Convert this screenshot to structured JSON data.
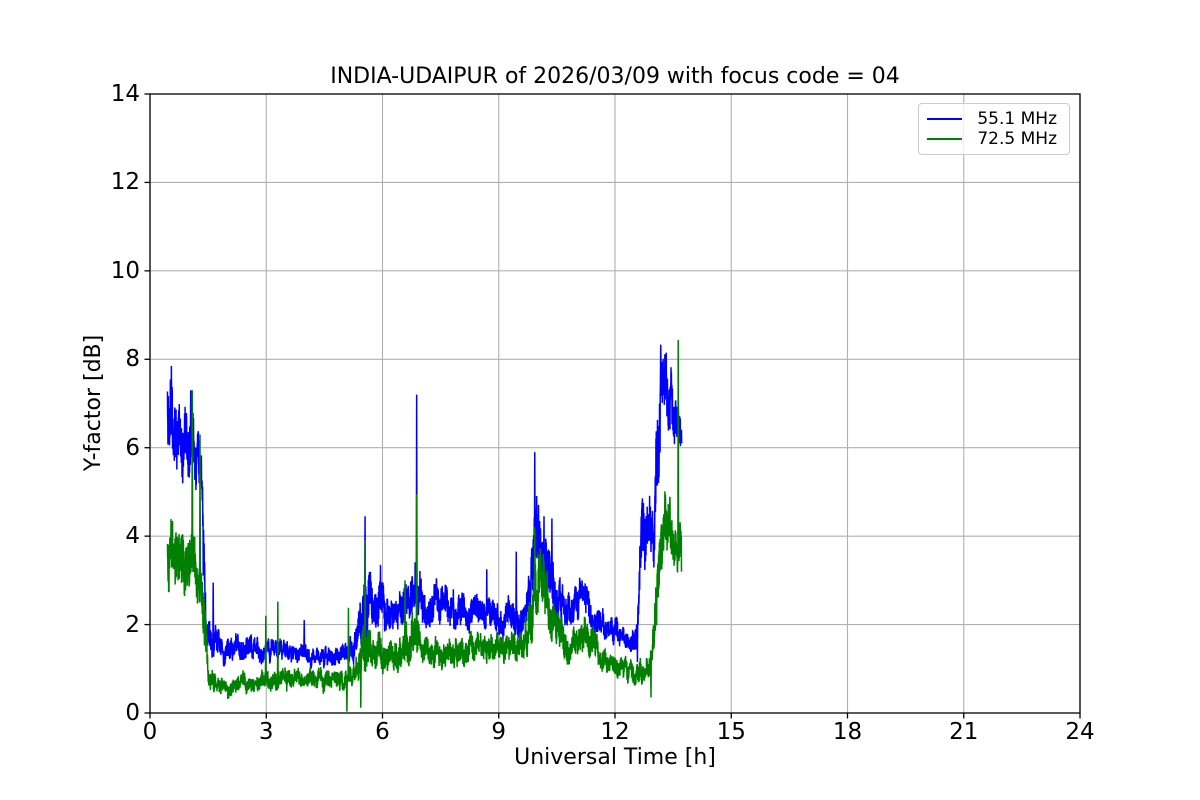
{
  "chart_data": {
    "type": "line",
    "title": "INDIA-UDAIPUR of 2026/03/09 with focus code = 04",
    "xlabel": "Universal Time [h]",
    "ylabel": "Y-factor [dB]",
    "xlim": [
      0,
      24
    ],
    "ylim": [
      0,
      14
    ],
    "xticks": [
      0,
      3,
      6,
      9,
      12,
      15,
      18,
      21,
      24
    ],
    "yticks": [
      0,
      2,
      4,
      6,
      8,
      10,
      12,
      14
    ],
    "grid": true,
    "grid_color": "#b0b0b0",
    "axis_color": "#000000",
    "legend_position": "upper right",
    "series": [
      {
        "name": "55.1 MHz",
        "color": "#0000ff",
        "seed": 42,
        "t_start": 0.45,
        "t_end": 13.72,
        "envelope": [
          [
            0.45,
            6.6,
            1.1
          ],
          [
            0.55,
            6.6,
            1.2
          ],
          [
            0.7,
            6.3,
            1.0
          ],
          [
            0.85,
            5.9,
            0.9
          ],
          [
            1.0,
            6.2,
            1.0
          ],
          [
            1.1,
            6.2,
            0.9
          ],
          [
            1.22,
            5.7,
            0.8
          ],
          [
            1.33,
            5.6,
            0.7
          ],
          [
            1.38,
            4.2,
            1.2
          ],
          [
            1.45,
            2.0,
            0.5
          ],
          [
            1.55,
            1.7,
            0.45
          ],
          [
            1.75,
            1.55,
            0.4
          ],
          [
            2.0,
            1.45,
            0.38
          ],
          [
            2.3,
            1.5,
            0.35
          ],
          [
            2.6,
            1.45,
            0.32
          ],
          [
            3.0,
            1.4,
            0.3
          ],
          [
            3.3,
            1.45,
            0.3
          ],
          [
            3.6,
            1.35,
            0.28
          ],
          [
            4.0,
            1.3,
            0.28
          ],
          [
            4.4,
            1.25,
            0.28
          ],
          [
            4.8,
            1.3,
            0.28
          ],
          [
            5.1,
            1.35,
            0.3
          ],
          [
            5.35,
            1.6,
            0.45
          ],
          [
            5.55,
            2.6,
            1.0
          ],
          [
            5.7,
            2.6,
            0.7
          ],
          [
            5.9,
            2.5,
            0.65
          ],
          [
            6.1,
            2.4,
            0.6
          ],
          [
            6.3,
            2.2,
            0.5
          ],
          [
            6.55,
            2.4,
            0.6
          ],
          [
            6.8,
            2.9,
            0.8
          ],
          [
            6.95,
            2.8,
            0.7
          ],
          [
            7.15,
            2.3,
            0.5
          ],
          [
            7.4,
            2.5,
            0.55
          ],
          [
            7.65,
            2.4,
            0.5
          ],
          [
            7.9,
            2.2,
            0.45
          ],
          [
            8.2,
            2.3,
            0.5
          ],
          [
            8.5,
            2.2,
            0.45
          ],
          [
            8.8,
            2.2,
            0.45
          ],
          [
            9.1,
            2.1,
            0.45
          ],
          [
            9.4,
            2.2,
            0.5
          ],
          [
            9.7,
            2.1,
            0.45
          ],
          [
            9.87,
            3.2,
            1.1
          ],
          [
            9.97,
            4.4,
            1.3
          ],
          [
            10.1,
            3.7,
            0.9
          ],
          [
            10.3,
            3.2,
            0.9
          ],
          [
            10.5,
            2.7,
            0.7
          ],
          [
            10.7,
            2.3,
            0.5
          ],
          [
            10.95,
            2.5,
            0.5
          ],
          [
            11.2,
            2.6,
            0.5
          ],
          [
            11.4,
            2.3,
            0.5
          ],
          [
            11.6,
            2.0,
            0.4
          ],
          [
            11.85,
            1.9,
            0.4
          ],
          [
            12.1,
            1.75,
            0.35
          ],
          [
            12.35,
            1.55,
            0.3
          ],
          [
            12.55,
            1.6,
            0.4
          ],
          [
            12.7,
            3.8,
            1.1
          ],
          [
            12.85,
            4.1,
            0.9
          ],
          [
            13.0,
            3.9,
            1.0
          ],
          [
            13.1,
            6.0,
            1.6
          ],
          [
            13.22,
            7.3,
            1.0
          ],
          [
            13.4,
            7.1,
            1.0
          ],
          [
            13.55,
            6.6,
            0.8
          ],
          [
            13.65,
            6.3,
            0.6
          ],
          [
            13.72,
            6.2,
            0.5
          ]
        ],
        "spikes": [
          [
            0.55,
            7.85
          ],
          [
            1.05,
            7.3
          ],
          [
            1.63,
            2.95
          ],
          [
            3.98,
            2.1
          ],
          [
            5.55,
            4.45
          ],
          [
            5.95,
            3.35
          ],
          [
            6.88,
            7.2
          ],
          [
            7.83,
            2.8
          ],
          [
            8.69,
            3.25
          ],
          [
            9.45,
            3.65
          ],
          [
            9.93,
            5.9
          ],
          [
            10.17,
            4.45
          ],
          [
            10.37,
            4.4
          ],
          [
            11.15,
            3.0
          ],
          [
            13.18,
            8.33
          ],
          [
            13.32,
            8.15
          ]
        ],
        "dips": [
          [
            12.58,
            1.15
          ]
        ]
      },
      {
        "name": "72.5 MHz",
        "color": "#008000",
        "seed": 1337,
        "t_start": 0.45,
        "t_end": 13.72,
        "envelope": [
          [
            0.45,
            3.6,
            1.0
          ],
          [
            0.6,
            3.7,
            1.0
          ],
          [
            0.8,
            3.4,
            0.9
          ],
          [
            1.0,
            3.5,
            0.9
          ],
          [
            1.15,
            3.3,
            0.85
          ],
          [
            1.3,
            3.1,
            0.7
          ],
          [
            1.4,
            2.2,
            0.9
          ],
          [
            1.5,
            0.9,
            0.35
          ],
          [
            1.65,
            0.72,
            0.3
          ],
          [
            1.9,
            0.62,
            0.27
          ],
          [
            2.2,
            0.62,
            0.27
          ],
          [
            2.6,
            0.72,
            0.28
          ],
          [
            3.0,
            0.76,
            0.3
          ],
          [
            3.4,
            0.78,
            0.3
          ],
          [
            3.8,
            0.74,
            0.28
          ],
          [
            4.2,
            0.78,
            0.3
          ],
          [
            4.6,
            0.76,
            0.3
          ],
          [
            5.0,
            0.8,
            0.3
          ],
          [
            5.3,
            0.9,
            0.35
          ],
          [
            5.55,
            1.7,
            0.8
          ],
          [
            5.7,
            1.3,
            0.5
          ],
          [
            5.95,
            1.4,
            0.5
          ],
          [
            6.2,
            1.3,
            0.45
          ],
          [
            6.5,
            1.35,
            0.5
          ],
          [
            6.8,
            1.9,
            0.8
          ],
          [
            6.95,
            1.6,
            0.5
          ],
          [
            7.2,
            1.3,
            0.4
          ],
          [
            7.5,
            1.4,
            0.4
          ],
          [
            7.8,
            1.35,
            0.4
          ],
          [
            8.1,
            1.45,
            0.42
          ],
          [
            8.4,
            1.5,
            0.42
          ],
          [
            8.7,
            1.45,
            0.4
          ],
          [
            9.0,
            1.4,
            0.4
          ],
          [
            9.3,
            1.5,
            0.42
          ],
          [
            9.6,
            1.45,
            0.4
          ],
          [
            9.87,
            2.2,
            0.9
          ],
          [
            9.97,
            3.2,
            1.0
          ],
          [
            10.1,
            2.8,
            0.8
          ],
          [
            10.3,
            2.4,
            0.75
          ],
          [
            10.5,
            1.9,
            0.55
          ],
          [
            10.75,
            1.55,
            0.45
          ],
          [
            11.0,
            1.7,
            0.5
          ],
          [
            11.25,
            1.75,
            0.5
          ],
          [
            11.45,
            1.55,
            0.45
          ],
          [
            11.65,
            1.2,
            0.35
          ],
          [
            11.95,
            1.1,
            0.33
          ],
          [
            12.25,
            1.0,
            0.32
          ],
          [
            12.55,
            0.92,
            0.32
          ],
          [
            12.95,
            1.1,
            0.4
          ],
          [
            13.05,
            2.0,
            0.9
          ],
          [
            13.15,
            3.6,
            0.9
          ],
          [
            13.25,
            4.3,
            0.85
          ],
          [
            13.45,
            4.2,
            0.85
          ],
          [
            13.6,
            4.1,
            0.8
          ],
          [
            13.72,
            3.5,
            0.7
          ]
        ],
        "spikes": [
          [
            1.09,
            7.3
          ],
          [
            1.29,
            6.3
          ],
          [
            2.99,
            2.2
          ],
          [
            3.3,
            2.52
          ],
          [
            5.12,
            2.38
          ],
          [
            5.55,
            3.9
          ],
          [
            6.58,
            3.0
          ],
          [
            6.88,
            4.95
          ],
          [
            9.93,
            4.2
          ],
          [
            10.15,
            3.6
          ],
          [
            13.63,
            8.44
          ]
        ],
        "dips": [
          [
            5.08,
            0.03
          ],
          [
            5.44,
            0.12
          ],
          [
            12.93,
            0.35
          ]
        ]
      }
    ]
  }
}
